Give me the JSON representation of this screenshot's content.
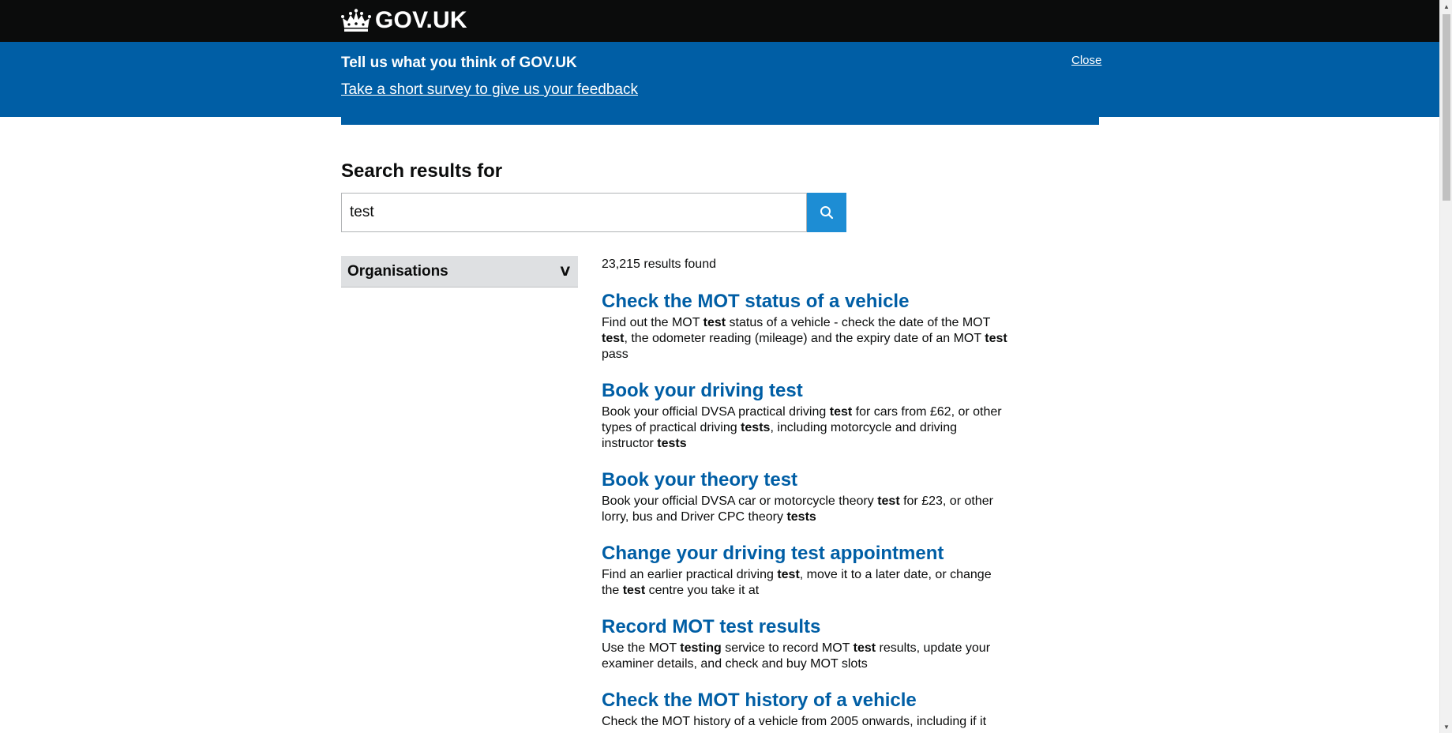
{
  "header": {
    "logo_text": "GOV.UK"
  },
  "survey": {
    "title": "Tell us what you think of GOV.UK",
    "link": "Take a short survey to give us your feedback",
    "close": "Close"
  },
  "search": {
    "heading": "Search results for",
    "value": "test",
    "button_icon": "search-icon"
  },
  "filter": {
    "label": "Organisations",
    "chevron": "V"
  },
  "results": {
    "count": "23,215 results found",
    "items": [
      {
        "title": "Check the MOT status of a vehicle",
        "desc": [
          [
            "Find out the MOT ",
            0
          ],
          [
            "test",
            1
          ],
          [
            " status of a vehicle - check the date of the MOT ",
            0
          ],
          [
            "test",
            1
          ],
          [
            ", the odometer reading (mileage) and the expiry date of an MOT ",
            0
          ],
          [
            "test",
            1
          ],
          [
            " pass",
            0
          ]
        ]
      },
      {
        "title": "Book your driving test",
        "desc": [
          [
            "Book your official DVSA practical driving ",
            0
          ],
          [
            "test",
            1
          ],
          [
            " for cars from £62, or other types of practical driving ",
            0
          ],
          [
            "tests",
            1
          ],
          [
            ", including motorcycle and driving instructor ",
            0
          ],
          [
            "tests",
            1
          ]
        ]
      },
      {
        "title": "Book your theory test",
        "desc": [
          [
            "Book your official DVSA car or motorcycle theory ",
            0
          ],
          [
            "test",
            1
          ],
          [
            " for £23, or other lorry, bus and Driver CPC theory ",
            0
          ],
          [
            "tests",
            1
          ]
        ]
      },
      {
        "title": "Change your driving test appointment",
        "desc": [
          [
            "Find an earlier practical driving ",
            0
          ],
          [
            "test",
            1
          ],
          [
            ", move it to a later date, or change the ",
            0
          ],
          [
            "test",
            1
          ],
          [
            " centre you take it at",
            0
          ]
        ]
      },
      {
        "title": "Record MOT test results",
        "desc": [
          [
            "Use the MOT ",
            0
          ],
          [
            "testing",
            1
          ],
          [
            " service to record MOT ",
            0
          ],
          [
            "test",
            1
          ],
          [
            " results, update your examiner details, and check and buy MOT slots",
            0
          ]
        ]
      },
      {
        "title": "Check the MOT history of a vehicle",
        "desc": [
          [
            "Check the MOT history of a vehicle from 2005 onwards, including if it",
            0
          ]
        ]
      }
    ]
  },
  "colors": {
    "header_bg": "#0b0c0c",
    "banner_bg": "#005ea5",
    "link": "#005ea5",
    "search_button": "#1d8dd4",
    "filter_bg": "#dee0e2"
  }
}
